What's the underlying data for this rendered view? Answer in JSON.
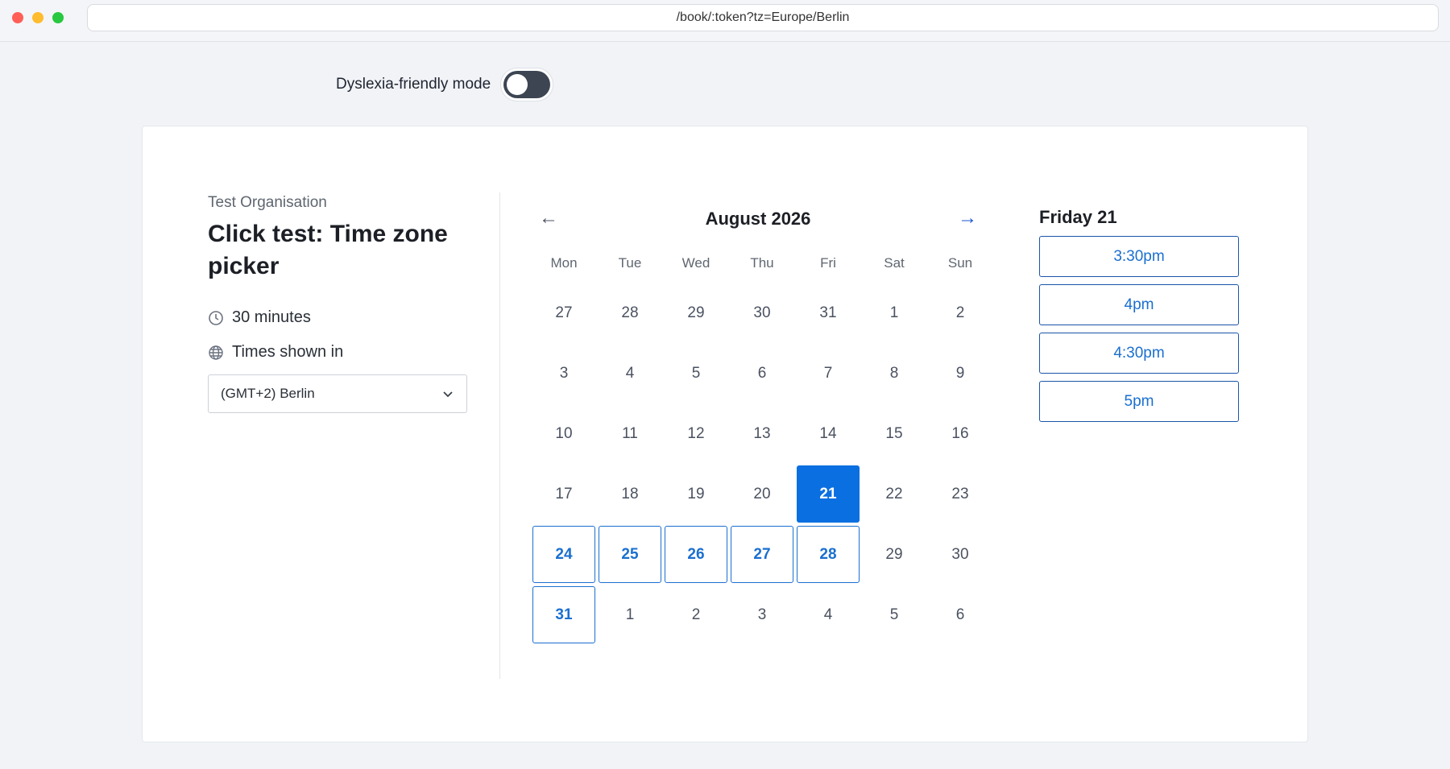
{
  "browser": {
    "url": "/book/:token?tz=Europe/Berlin"
  },
  "accessibility": {
    "dyslexia_label": "Dyslexia-friendly mode",
    "dyslexia_enabled": false
  },
  "event": {
    "organisation": "Test Organisation",
    "title": "Click test: Time zone picker",
    "duration": "30 minutes",
    "timezone_label": "Times shown in",
    "timezone_value": "(GMT+2) Berlin"
  },
  "calendar": {
    "prev_icon": "arrow-left-icon",
    "next_icon": "arrow-right-icon",
    "prev_glyph": "←",
    "next_glyph": "→",
    "month": "August 2026",
    "weekdays": [
      "Mon",
      "Tue",
      "Wed",
      "Thu",
      "Fri",
      "Sat",
      "Sun"
    ],
    "days": [
      {
        "label": "27",
        "state": "muted"
      },
      {
        "label": "28",
        "state": "muted"
      },
      {
        "label": "29",
        "state": "muted"
      },
      {
        "label": "30",
        "state": "muted"
      },
      {
        "label": "31",
        "state": "muted"
      },
      {
        "label": "1",
        "state": "muted"
      },
      {
        "label": "2",
        "state": "muted"
      },
      {
        "label": "3",
        "state": "muted"
      },
      {
        "label": "4",
        "state": "muted"
      },
      {
        "label": "5",
        "state": "muted"
      },
      {
        "label": "6",
        "state": "muted"
      },
      {
        "label": "7",
        "state": "muted"
      },
      {
        "label": "8",
        "state": "muted"
      },
      {
        "label": "9",
        "state": "muted"
      },
      {
        "label": "10",
        "state": "muted"
      },
      {
        "label": "11",
        "state": "muted"
      },
      {
        "label": "12",
        "state": "muted"
      },
      {
        "label": "13",
        "state": "muted"
      },
      {
        "label": "14",
        "state": "muted"
      },
      {
        "label": "15",
        "state": "muted"
      },
      {
        "label": "16",
        "state": "muted"
      },
      {
        "label": "17",
        "state": "muted"
      },
      {
        "label": "18",
        "state": "muted"
      },
      {
        "label": "19",
        "state": "muted"
      },
      {
        "label": "20",
        "state": "muted"
      },
      {
        "label": "21",
        "state": "selected"
      },
      {
        "label": "22",
        "state": "muted"
      },
      {
        "label": "23",
        "state": "muted"
      },
      {
        "label": "24",
        "state": "available"
      },
      {
        "label": "25",
        "state": "available"
      },
      {
        "label": "26",
        "state": "available"
      },
      {
        "label": "27",
        "state": "available"
      },
      {
        "label": "28",
        "state": "available"
      },
      {
        "label": "29",
        "state": "muted"
      },
      {
        "label": "30",
        "state": "muted"
      },
      {
        "label": "31",
        "state": "available"
      },
      {
        "label": "1",
        "state": "muted"
      },
      {
        "label": "2",
        "state": "muted"
      },
      {
        "label": "3",
        "state": "muted"
      },
      {
        "label": "4",
        "state": "muted"
      },
      {
        "label": "5",
        "state": "muted"
      },
      {
        "label": "6",
        "state": "muted"
      }
    ]
  },
  "slots": {
    "date_label": "Friday 21",
    "times": [
      "3:30pm",
      "4pm",
      "4:30pm",
      "5pm"
    ]
  },
  "colors": {
    "accent": "#0a6fe0",
    "available_text": "#1a6fd0",
    "toggle_off": "#3d4553"
  }
}
